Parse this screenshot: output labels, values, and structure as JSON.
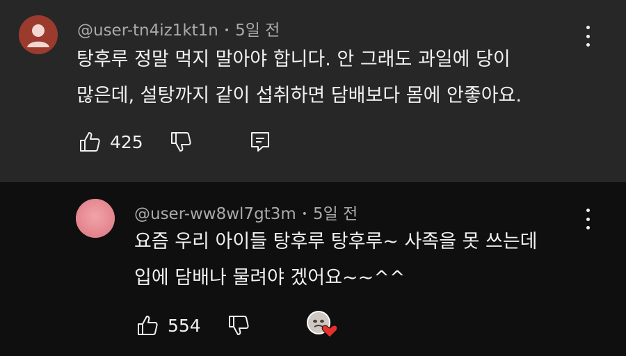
{
  "comments": [
    {
      "author": "@user-tn4iz1kt1n",
      "time": "5일 전",
      "lines": [
        "탕후루 정말 먹지 말아야 합니다. 안 그래도 과일에 당이",
        "많은데, 설탕까지 같이 섭취하면 담배보다 몸에 안좋아요."
      ],
      "likes": "425",
      "avatar_color": "#9b3b2e"
    },
    {
      "author": "@user-ww8wl7gt3m",
      "time": "5일 전",
      "lines": [
        "요즘 우리 아이들 탕후루 탕후루~ 사족을 못 쓰는데",
        "입에 담배나 물려야 겠어요~~^^"
      ],
      "likes": "554",
      "avatar_color": "#e88a93",
      "heart_color": "#e8302a"
    }
  ],
  "separator": "•"
}
